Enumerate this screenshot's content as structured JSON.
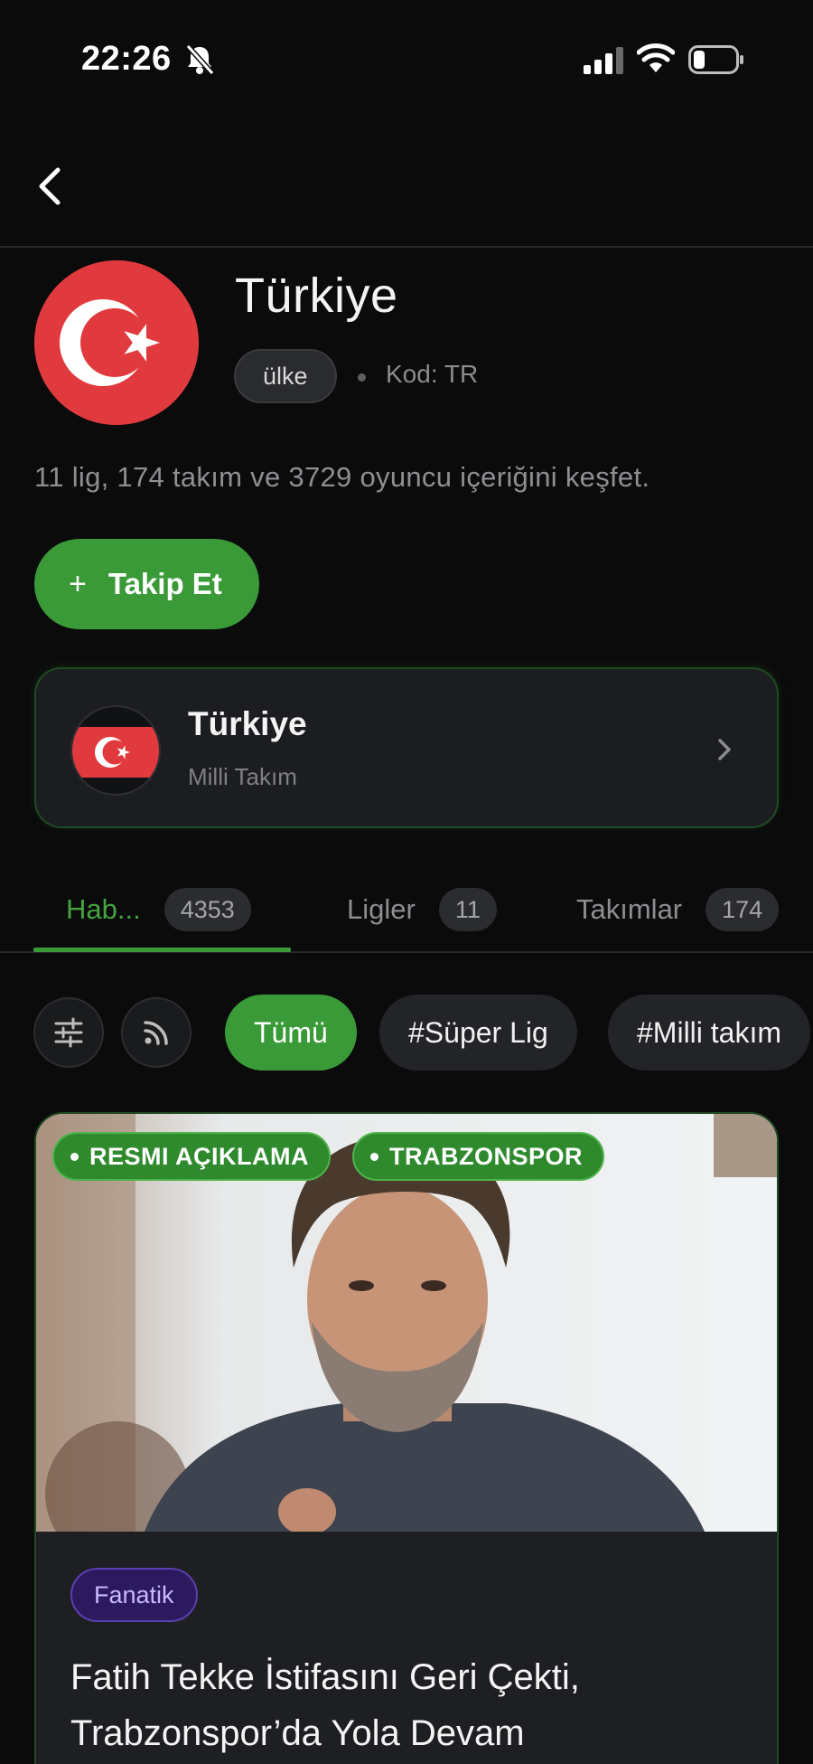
{
  "status_bar": {
    "time": "22:26"
  },
  "header": {
    "country_name": "Türkiye",
    "type_label": "ülke",
    "code_label": "Kod: TR",
    "summary": "11 lig, 174 takım ve 3729 oyuncu içeriğini keşfet.",
    "follow_label": "Takip Et"
  },
  "team_card": {
    "name": "Türkiye",
    "subtitle": "Milli Takım"
  },
  "tabs": [
    {
      "label": "Hab...",
      "count": "4353",
      "active": true
    },
    {
      "label": "Ligler",
      "count": "11",
      "active": false
    },
    {
      "label": "Takımlar",
      "count": "174",
      "active": false
    }
  ],
  "filters": {
    "chips": [
      {
        "label": "Tümü",
        "active": true
      },
      {
        "label": "#Süper Lig",
        "active": false
      },
      {
        "label": "#Milli takım",
        "active": false
      }
    ]
  },
  "news": {
    "tags": [
      "RESMI AÇIKLAMA",
      "TRABZONSPOR"
    ],
    "source": "Fanatik",
    "headline_line1": "Fatih Tekke İstifasını Geri Çekti,",
    "headline_line2": "Trabzonspor’da Yola Devam"
  },
  "colors": {
    "accent": "#3a9a38",
    "background": "#0b0b0c",
    "card": "#1c1d20",
    "flag_red": "#e03a3e"
  }
}
